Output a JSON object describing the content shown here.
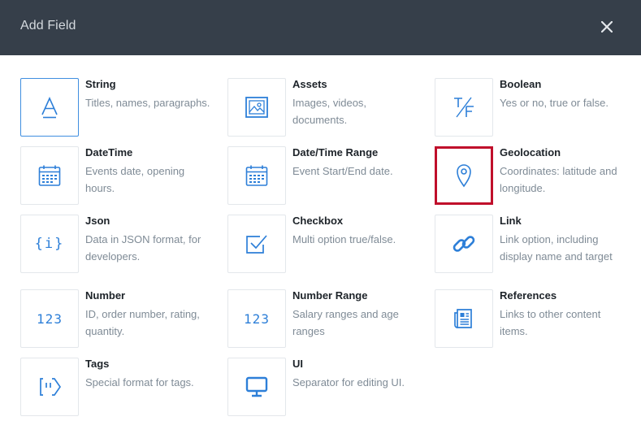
{
  "dialog": {
    "title": "Add Field",
    "close_icon": "close-icon"
  },
  "colors": {
    "header_bg": "#363f4a",
    "icon_blue": "#2d7fd8",
    "highlight_red": "#c00f2b",
    "selected_border": "#3f8ee0"
  },
  "fields": [
    {
      "name": "String",
      "description": "Titles, names, paragraphs.",
      "icon": "text-a-icon",
      "selected": true
    },
    {
      "name": "Assets",
      "description": "Images, videos, documents.",
      "icon": "image-icon"
    },
    {
      "name": "Boolean",
      "description": "Yes or no, true or false.",
      "icon": "true-false-icon"
    },
    {
      "name": "DateTime",
      "description": "Events date, opening hours.",
      "icon": "calendar-icon"
    },
    {
      "name": "Date/Time Range",
      "description": "Event Start/End date.",
      "icon": "calendar-icon"
    },
    {
      "name": "Geolocation",
      "description": "Coordinates: latitude and longitude.",
      "icon": "map-pin-icon",
      "highlighted": true
    },
    {
      "name": "Json",
      "description": "Data in JSON format, for developers.",
      "icon": "braces-icon",
      "glyph": "{i}"
    },
    {
      "name": "Checkbox",
      "description": "Multi option true/false.",
      "icon": "checkbox-icon"
    },
    {
      "name": "Link",
      "description": "Link option, including display name and target",
      "icon": "link-icon"
    },
    {
      "name": "Number",
      "description": "ID, order number, rating, quantity.",
      "icon": "number-icon",
      "glyph": "123"
    },
    {
      "name": "Number Range",
      "description": "Salary ranges and age ranges",
      "icon": "number-range-icon",
      "glyph": "123"
    },
    {
      "name": "References",
      "description": "Links to other content items.",
      "icon": "references-icon"
    },
    {
      "name": "Tags",
      "description": "Special format for tags.",
      "icon": "tag-icon"
    },
    {
      "name": "UI",
      "description": "Separator for editing UI.",
      "icon": "monitor-icon"
    }
  ]
}
